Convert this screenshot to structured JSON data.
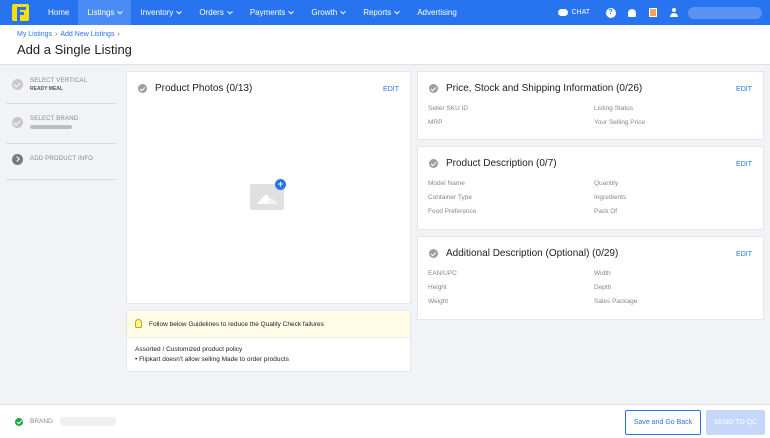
{
  "nav": {
    "items": [
      {
        "label": "Home"
      },
      {
        "label": "Listings"
      },
      {
        "label": "Inventory"
      },
      {
        "label": "Orders"
      },
      {
        "label": "Payments"
      },
      {
        "label": "Growth"
      },
      {
        "label": "Reports"
      },
      {
        "label": "Advertising"
      }
    ],
    "active": "Listings",
    "chat_label": "CHAT",
    "help_glyph": "?",
    "accent": "#2874f0"
  },
  "breadcrumb": {
    "items": [
      "My Listings",
      "Add New Listings"
    ]
  },
  "page": {
    "title": "Add a Single Listing"
  },
  "sidebar": {
    "steps": [
      {
        "title": "SELECT VERTICAL",
        "value": "READY MEAL",
        "status": "done"
      },
      {
        "title": "SELECT BRAND",
        "status": "done"
      },
      {
        "title": "ADD PRODUCT INFO",
        "status": "current"
      }
    ]
  },
  "photos_card": {
    "title": "Product Photos (0/13)",
    "edit_label": "EDIT"
  },
  "guidelines": {
    "banner": "Follow below Guidelines to reduce the Quality Check failures",
    "policy_title": "Assorted / Customized product policy",
    "policy_item": "• Flipkart doesn't allow selling Made to order products"
  },
  "price_card": {
    "title": "Price, Stock and Shipping Information (0/26)",
    "edit_label": "EDIT",
    "fields": [
      "Seller SKU ID",
      "Listing Status",
      "MRP",
      "Your Selling Price"
    ]
  },
  "description_card": {
    "title": "Product Description (0/7)",
    "edit_label": "EDIT",
    "fields": [
      "Model Name",
      "Quantity",
      "Container Type",
      "Ingredients",
      "Food Preference",
      "Pack Of"
    ]
  },
  "additional_card": {
    "title": "Additional Description (Optional) (0/29)",
    "edit_label": "EDIT",
    "fields": [
      "EAN/UPC",
      "Width",
      "Height",
      "Depth",
      "Weight",
      "Sales Package"
    ]
  },
  "footer": {
    "brand_label": "BRAND",
    "save_back_label": "Save and Go Back",
    "send_qc_label": "SEND TO QC"
  }
}
